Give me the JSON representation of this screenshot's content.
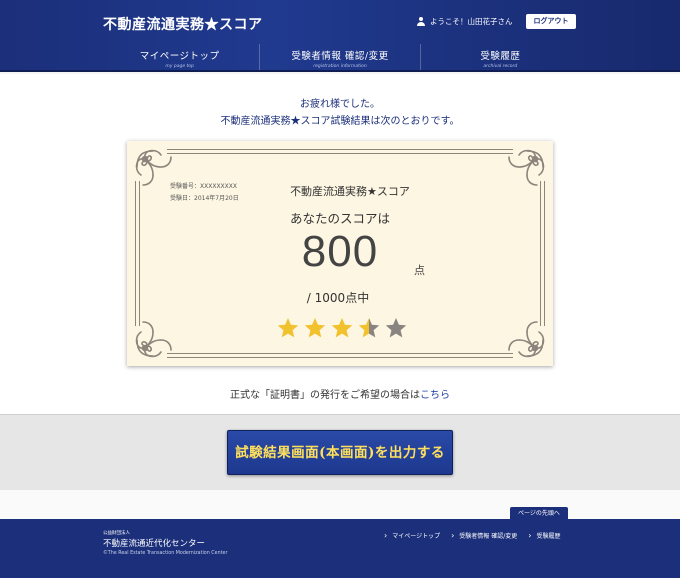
{
  "header": {
    "site_title": "不動産流通実務★スコア",
    "welcome": "ようこそ！山田花子さん",
    "logout_label": "ログアウト"
  },
  "nav": [
    {
      "label": "マイページトップ",
      "sub": "my page top"
    },
    {
      "label": "受験者情報 確認/変更",
      "sub": "registration information"
    },
    {
      "label": "受験履歴",
      "sub": "archival record"
    }
  ],
  "message": {
    "line1": "お疲れ様でした。",
    "line2": "不動産流通実務★スコア試験結果は次のとおりです。"
  },
  "certificate": {
    "exam_number": "受験番号：XXXXXXXXX",
    "exam_date": "受験日：2014年7月20日",
    "title": "不動産流通実務★スコア",
    "subtitle": "あなたのスコアは",
    "score": "800",
    "score_unit": "点",
    "max_score": "/ 1000点中",
    "stars": {
      "filled": 3.5,
      "total": 5,
      "filled_color": "#f2c12e",
      "empty_color": "#8a8480"
    }
  },
  "certificate_note": {
    "text": "正式な「証明書」の発行をご希望の場合は",
    "link": "こちら"
  },
  "output_button": "試験結果画面(本画面)を出力する",
  "page_top": "ページの先頭へ",
  "footer": {
    "org_type": "公益財団法人",
    "org_name": "不動産流通近代化センター",
    "copyright": "©The Real Estate Transaction Modernization Center",
    "links": [
      "マイページトップ",
      "受験者情報 確認/変更",
      "受験履歴"
    ]
  }
}
